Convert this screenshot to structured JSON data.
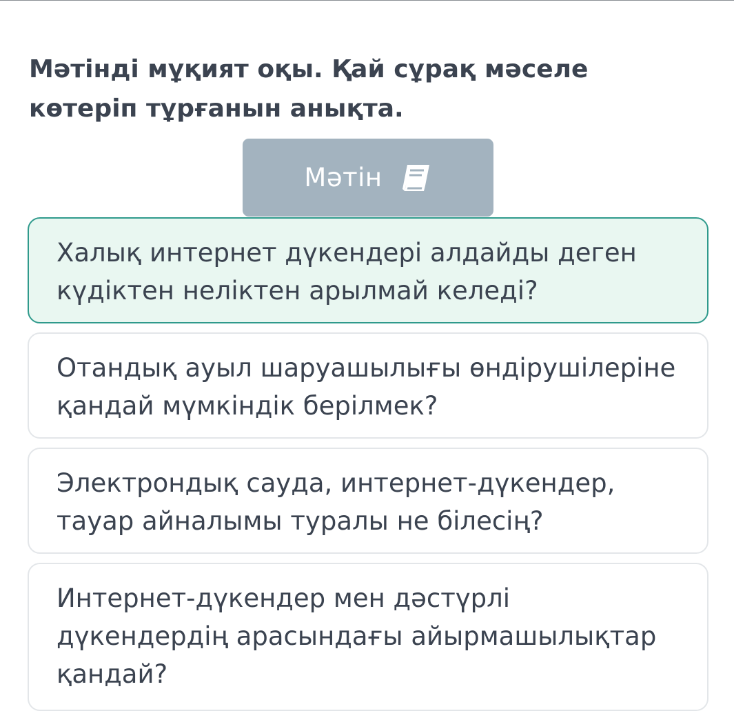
{
  "question": {
    "title": "Мәтінді мұқият оқы. Қай сұрақ мәселе көтеріп тұрғанын анықта."
  },
  "text_button": {
    "label": "Мәтін",
    "icon": "book-icon",
    "background": "#a3b3bf"
  },
  "options": [
    {
      "text": "Халық интернет дүкендері алдайды деген күдіктен неліктен арылмай келеді?",
      "selected": true
    },
    {
      "text": "Отандық ауыл шаруашылығы өндірушілеріне қандай мүмкіндік берілмек?",
      "selected": false
    },
    {
      "text": "Электрондық сауда, интернет-дүкендер, тауар айналымы туралы не білесің?",
      "selected": false
    },
    {
      "text": "Интернет-дүкендер мен дәстүрлі дүкендердің арасындағы айырмашылықтар қандай?",
      "selected": false
    }
  ],
  "colors": {
    "text": "#3b4350",
    "selected_border": "#2f9a8c",
    "selected_background": "#e9f7f1",
    "option_border": "#e3e6e9"
  }
}
